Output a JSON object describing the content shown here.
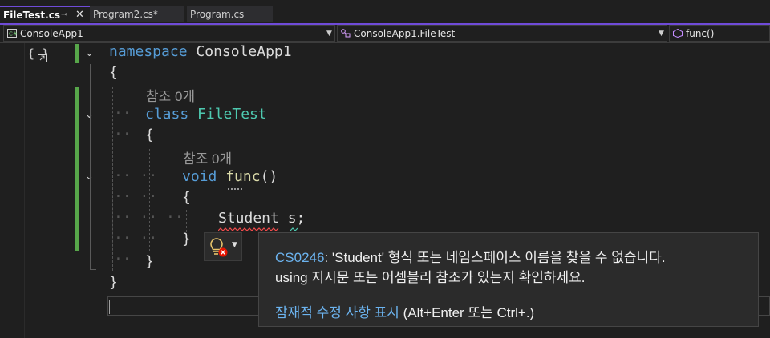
{
  "tabs": [
    {
      "label": "FileTest.cs",
      "active": true
    },
    {
      "label": "Program2.cs*",
      "active": false
    },
    {
      "label": "Program.cs",
      "active": false
    }
  ],
  "tab_pin_glyph": "⊸",
  "tab_close_glyph": "✕",
  "navbar": {
    "project": "ConsoleApp1",
    "class": "ConsoleApp1.FileTest",
    "member": "func()"
  },
  "code": {
    "namespace_kw": "namespace",
    "namespace_name": "ConsoleApp1",
    "open_brace_1": "{",
    "ref_1": "참조 0개",
    "class_kw": "class",
    "class_name": "FileTest",
    "open_brace_2": "{",
    "ref_2": "참조 0개",
    "void_kw": "void",
    "func_name": "func",
    "func_parens": "()",
    "open_brace_3": "{",
    "student_type": "Student",
    "student_var": "s;",
    "close_brace_3": "}",
    "close_brace_2": "}",
    "close_brace_1": "}"
  },
  "tooltip": {
    "error_code": "CS0246",
    "line1_rest": ": 'Student' 형식 또는 네임스페이스 이름을 찾을 수 없습니다.",
    "line2": "using 지시문 또는 어셈블리 참조가 있는지 확인하세요.",
    "fix_link": "잠재적 수정 사항 표시",
    "fix_shortcut": " (Alt+Enter 또는 Ctrl+.)"
  },
  "colors": {
    "accent": "#6f4bd8",
    "keyword": "#569cd6",
    "type": "#4ec9b0",
    "function": "#dcdcaa",
    "error": "#f14c4c",
    "link": "#6cb4f0",
    "change_bar": "#57a64a"
  },
  "icons": {
    "project_icon": "csharp-project-icon",
    "class_icon": "class-icon",
    "member_icon": "method-icon",
    "lightbulb_icon": "lightbulb-error-icon",
    "collapse_icon": "chevron-down-icon"
  }
}
